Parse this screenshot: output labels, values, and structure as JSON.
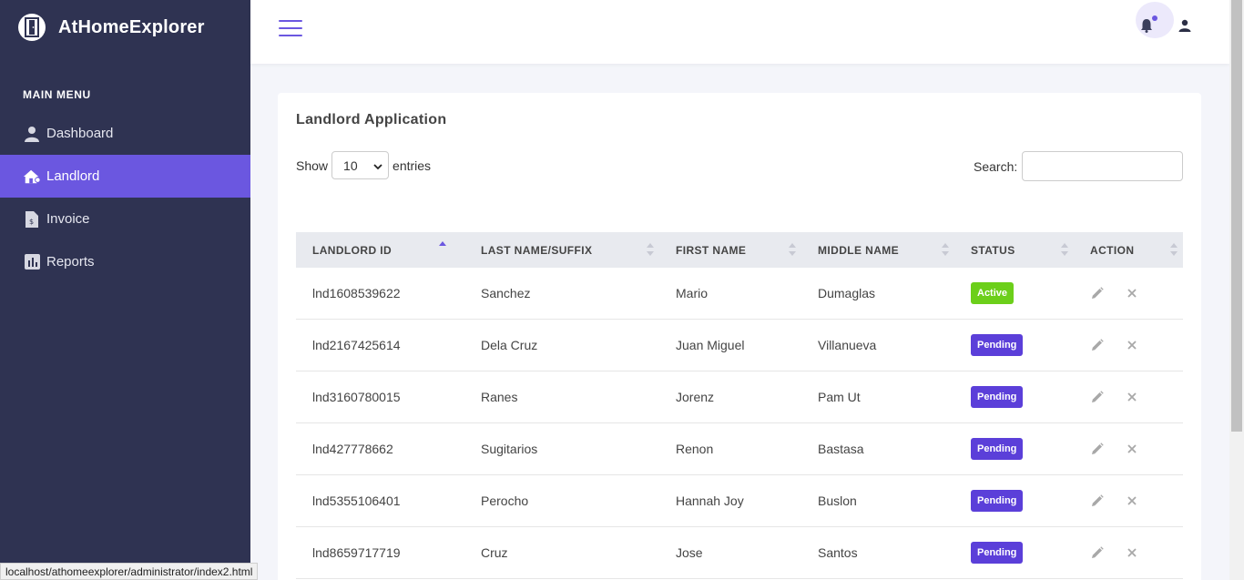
{
  "brand": {
    "name": "AtHomeExplorer"
  },
  "sidebar": {
    "heading": "MAIN MENU",
    "items": [
      {
        "label": "Dashboard",
        "icon": "user-icon"
      },
      {
        "label": "Landlord",
        "icon": "home-icon",
        "active": true
      },
      {
        "label": "Invoice",
        "icon": "invoice-icon"
      },
      {
        "label": "Reports",
        "icon": "chart-icon"
      }
    ]
  },
  "colors": {
    "sidebar": "#2f3352",
    "accent": "#6b57e0",
    "active_badge": "#6ccf1a",
    "pending_badge": "#5b3fd9"
  },
  "card": {
    "title": "Landlord Application",
    "show_label": "Show",
    "entries_value": "10",
    "entries_label": "entries",
    "search_label": "Search:",
    "search_value": ""
  },
  "table": {
    "headers": [
      "LANDLORD ID",
      "LAST NAME/SUFFIX",
      "FIRST NAME",
      "MIDDLE NAME",
      "STATUS",
      "ACTION"
    ],
    "rows": [
      {
        "id": "lnd1608539622",
        "last": "Sanchez",
        "first": "Mario",
        "middle": "Dumaglas",
        "status": "Active"
      },
      {
        "id": "lnd2167425614",
        "last": "Dela Cruz",
        "first": "Juan Miguel",
        "middle": "Villanueva",
        "status": "Pending"
      },
      {
        "id": "lnd3160780015",
        "last": "Ranes",
        "first": "Jorenz",
        "middle": "Pam Ut",
        "status": "Pending"
      },
      {
        "id": "lnd427778662",
        "last": "Sugitarios",
        "first": "Renon",
        "middle": "Bastasa",
        "status": "Pending"
      },
      {
        "id": "lnd5355106401",
        "last": "Perocho",
        "first": "Hannah Joy",
        "middle": "Buslon",
        "status": "Pending"
      },
      {
        "id": "lnd8659717719",
        "last": "Cruz",
        "first": "Jose",
        "middle": "Santos",
        "status": "Pending"
      }
    ]
  },
  "statusbar": {
    "url": "localhost/athomeexplorer/administrator/index2.html"
  }
}
